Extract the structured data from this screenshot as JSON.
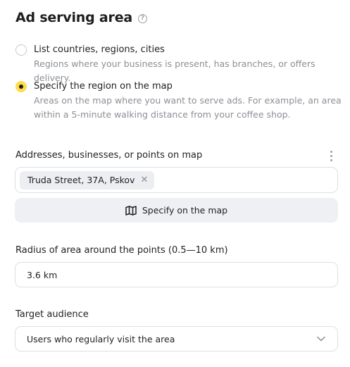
{
  "section": {
    "title": "Ad serving area"
  },
  "options": [
    {
      "label": "List countries, regions, cities",
      "description": "Regions where your business is present, has branches, or offers delivery.",
      "selected": false
    },
    {
      "label": "Specify the region on the map",
      "description_line1": "Areas on the map where you want to serve ads. For example, an area",
      "description_line2": "within a 5-minute walking distance from your coffee shop.",
      "selected": true
    }
  ],
  "addresses": {
    "label": "Addresses, businesses, or points on map",
    "tags": [
      "Truda Street, 37A, Pskov"
    ],
    "map_button_label": "Specify on the map"
  },
  "radius": {
    "label": "Radius of area around the points (0.5—10 km)",
    "value": "3.6 km"
  },
  "audience": {
    "label": "Target audience",
    "value": "Users who regularly visit the area"
  },
  "colors": {
    "accent": "#ffdb4d",
    "muted_text": "#8b8f95",
    "border": "#dcdfe3",
    "button_bg": "#eef0f3"
  }
}
